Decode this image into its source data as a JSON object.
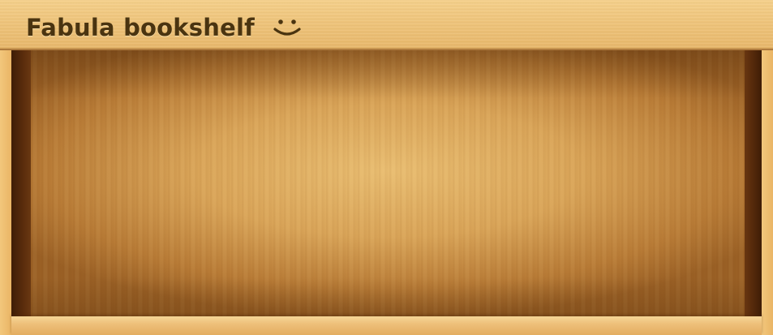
{
  "app": {
    "title": "Fabula bookshelf"
  },
  "header": {
    "icon": "smiley-icon"
  },
  "colors": {
    "title_text": "#4a3410",
    "wood_light": "#f0c477",
    "wood_dark": "#3e1d06"
  },
  "shelf": {
    "books": []
  }
}
